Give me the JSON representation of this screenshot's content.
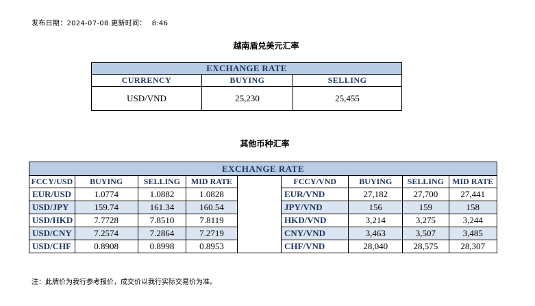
{
  "header": {
    "publish_label": "发布日期：2024-07-08 更新时间：",
    "publish_time": "8:46"
  },
  "vnd_section": {
    "title": "越南盾兑美元汇率",
    "table_title": "EXCHANGE RATE",
    "columns": [
      "CURRENCY",
      "BUYING",
      "SELLING"
    ],
    "row": {
      "currency": "USD/VND",
      "buying": "25,230",
      "selling": "25,455"
    }
  },
  "other_section": {
    "title": "其他币种汇率",
    "table_title": "EXCHANGE  RATE",
    "left_columns": [
      "FCCY/USD",
      "BUYING",
      "SELLING",
      "MID RATE"
    ],
    "right_columns": [
      "FCCY/VND",
      "BUYING",
      "SELLING",
      "MID RATE"
    ],
    "rows": [
      {
        "l_pair": "EUR/USD",
        "l_buy": "1.0774",
        "l_sell": "1.0882",
        "l_mid": "1.0828",
        "r_pair": "EUR/VND",
        "r_buy": "27,182",
        "r_sell": "27,700",
        "r_mid": "27,441"
      },
      {
        "l_pair": "USD/JPY",
        "l_buy": "159.74",
        "l_sell": "161.34",
        "l_mid": "160.54",
        "r_pair": "JPY/VND",
        "r_buy": "156",
        "r_sell": "159",
        "r_mid": "158"
      },
      {
        "l_pair": "USD/HKD",
        "l_buy": "7.7728",
        "l_sell": "7.8510",
        "l_mid": "7.8119",
        "r_pair": "HKD/VND",
        "r_buy": "3,214",
        "r_sell": "3,275",
        "r_mid": "3,244"
      },
      {
        "l_pair": "USD/CNY",
        "l_buy": "7.2574",
        "l_sell": "7.2864",
        "l_mid": "7.2719",
        "r_pair": "CNY/VND",
        "r_buy": "3,463",
        "r_sell": "3,507",
        "r_mid": "3,485"
      },
      {
        "l_pair": "USD/CHF",
        "l_buy": "0.8908",
        "l_sell": "0.8998",
        "l_mid": "0.8953",
        "r_pair": "CHF/VND",
        "r_buy": "28,040",
        "r_sell": "28,575",
        "r_mid": "28,307"
      }
    ]
  },
  "footer": {
    "note": "注：此牌价为我行参考报价，成交价以我行实际交易价为准。"
  },
  "colors": {
    "header_fill": "#b8cce4",
    "alt_row_fill": "#dbe5f1",
    "header_text": "#1f3864"
  }
}
